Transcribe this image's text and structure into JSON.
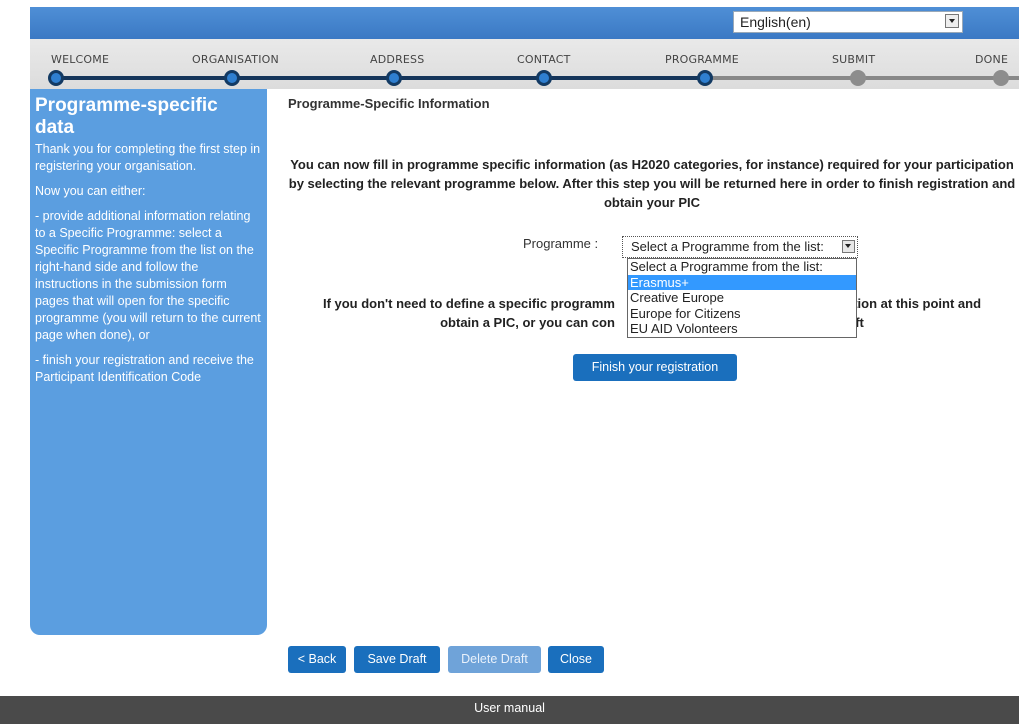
{
  "language": {
    "selected": "English(en)"
  },
  "steps": [
    {
      "label": "WELCOME",
      "state": "done"
    },
    {
      "label": "ORGANISATION",
      "state": "done"
    },
    {
      "label": "ADDRESS",
      "state": "done"
    },
    {
      "label": "CONTACT",
      "state": "done"
    },
    {
      "label": "PROGRAMME",
      "state": "current"
    },
    {
      "label": "SUBMIT",
      "state": "todo"
    },
    {
      "label": "DONE",
      "state": "todo"
    }
  ],
  "sidebar": {
    "title": "Programme-specific data",
    "p1": "Thank you for completing the first step in registering your organisation.",
    "p2": "Now you can either:",
    "p3": "- provide additional information relating to a Specific Programme: select a Specific Programme from the list on the right-hand side and follow the instructions in the submission form pages that will open for the specific programme (you will return to the current page when done), or",
    "p4": "- finish your registration and receive the Participant Identification Code"
  },
  "main": {
    "section_title": "Programme-Specific Information",
    "intro": "You can now fill in programme specific information (as H2020 categories, for instance) required for your participation by selecting the relevant programme below. After this step you will be returned here in order to finish registration and obtain your PIC",
    "programme_label": "Programme :",
    "programme_selected": "Select a Programme from the list:",
    "programme_options": [
      "Select a Programme from the list:",
      "Erasmus+",
      "Creative Europe",
      "Europe for Citizens",
      "EU AID Volonteers"
    ],
    "highlighted_option": "Erasmus+",
    "notice_line1": "If you don't need to define a specific programm",
    "notice_line1_end": "ation at this point and",
    "notice_line2": "obtain a PIC, or you can con",
    "notice_line2_end": "raft",
    "finish_button": "Finish your registration"
  },
  "actions": {
    "back": "< Back",
    "save_draft": "Save Draft",
    "delete_draft": "Delete Draft",
    "close": "Close"
  },
  "footer": {
    "user_manual": "User manual"
  }
}
